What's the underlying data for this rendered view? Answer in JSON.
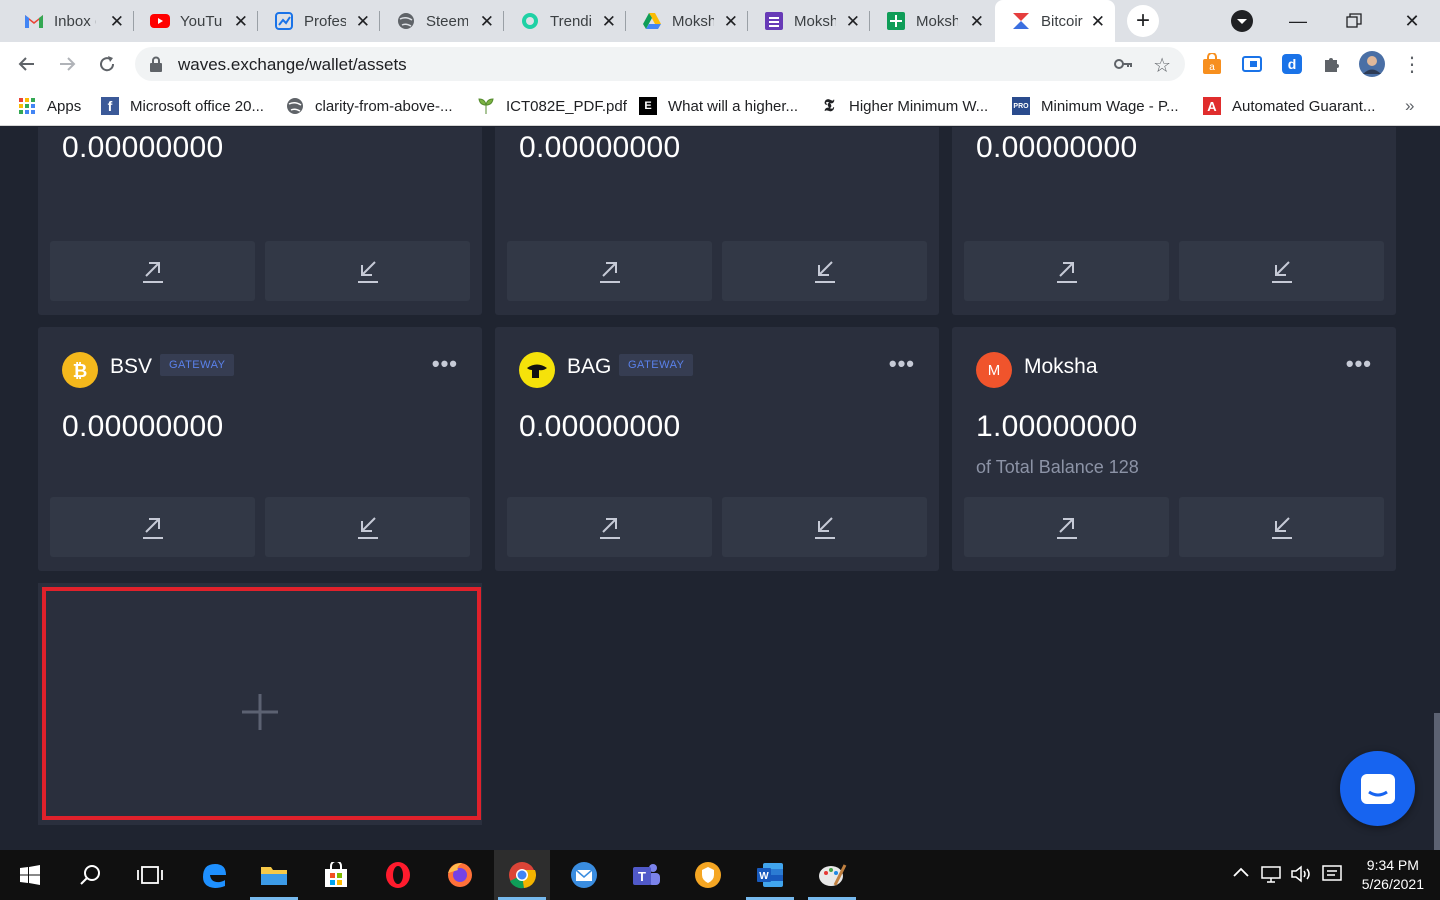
{
  "browser": {
    "tabs": [
      {
        "label": "Inbox (",
        "icon": "gmail-icon"
      },
      {
        "label": "YouTul",
        "icon": "youtube-icon"
      },
      {
        "label": "Profes",
        "icon": "chart-icon"
      },
      {
        "label": "Steem",
        "icon": "globe-icon"
      },
      {
        "label": "Trendi",
        "icon": "steemit-icon"
      },
      {
        "label": "Moksh",
        "icon": "google-drive-icon"
      },
      {
        "label": "Moksh",
        "icon": "google-forms-icon"
      },
      {
        "label": "Moksh",
        "icon": "google-sheets-icon"
      },
      {
        "label": "Bitcoir",
        "icon": "waves-icon",
        "active": true
      }
    ],
    "url": "waves.exchange/wallet/assets",
    "bookmarks": [
      {
        "label": "Apps",
        "icon": "apps-grid-icon"
      },
      {
        "label": "Microsoft office 20...",
        "icon": "facebook-icon"
      },
      {
        "label": "clarity-from-above-...",
        "icon": "globe-icon"
      },
      {
        "label": "ICT082E_PDF.pdf",
        "icon": "leaf-icon"
      },
      {
        "label": "What will a higher...",
        "icon": "economist-icon"
      },
      {
        "label": "Higher Minimum W...",
        "icon": "nytimes-icon"
      },
      {
        "label": "Minimum Wage - P...",
        "icon": "procon-icon"
      },
      {
        "label": "Automated Guarant...",
        "icon": "acrobat-icon"
      }
    ],
    "more_bookmarks": "»"
  },
  "wallet": {
    "top_cards": [
      {
        "amount": "0.00000000"
      },
      {
        "amount": "0.00000000"
      },
      {
        "amount": "0.00000000"
      }
    ],
    "assets": [
      {
        "name": "BSV",
        "badge": "GATEWAY",
        "amount": "0.00000000",
        "icon": "bitcoin-sv-icon",
        "color": "#f4b81c"
      },
      {
        "name": "BAG",
        "badge": "GATEWAY",
        "amount": "0.00000000",
        "icon": "bag-token-icon",
        "color": "#f5e20a"
      },
      {
        "name": "Moksha",
        "badge": "",
        "amount": "1.00000000",
        "subtext": "of Total Balance 128",
        "icon_letter": "M",
        "icon": "moksha-token-icon",
        "color": "#f0542c"
      }
    ],
    "menu_label": "•••",
    "add_asset_icon": "plus-icon"
  },
  "colors": {
    "page_bg": "#1f2430",
    "card_bg": "#2a2f3d",
    "button_bg": "#323846",
    "badge_text": "#5a81ea",
    "highlight": "#e0212b",
    "chat_button": "#1764f0"
  },
  "taskbar": {
    "time": "9:34 PM",
    "date": "5/26/2021"
  }
}
